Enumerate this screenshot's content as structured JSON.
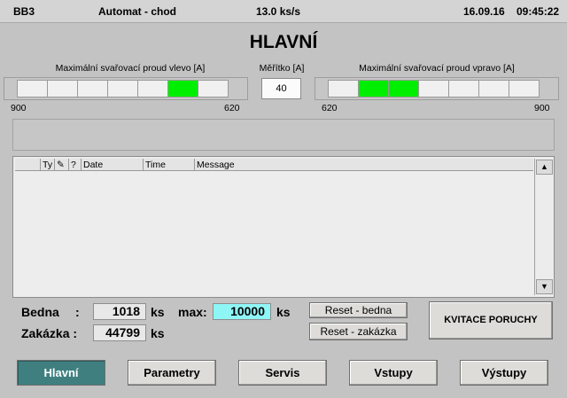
{
  "status": {
    "station": "BB3",
    "mode": "Automat - chod",
    "rate": "13.0 ks/s",
    "date": "16.09.16",
    "time": "09:45:22"
  },
  "title": "HLAVNÍ",
  "gauge_left": {
    "label": "Maximální svařovací proud vlevo [A]",
    "min_label": "900",
    "max_label": "620",
    "segments": [
      false,
      false,
      false,
      false,
      false,
      true,
      false
    ]
  },
  "scale": {
    "label": "Měřítko [A]",
    "value": "40"
  },
  "gauge_right": {
    "label": "Maximální svařovací proud vpravo [A]",
    "min_label": "620",
    "max_label": "900",
    "segments": [
      false,
      true,
      true,
      false,
      false,
      false,
      false
    ]
  },
  "messages": {
    "columns": [
      "Ty",
      "",
      "?",
      "Date",
      "Time",
      "Message"
    ],
    "rows": []
  },
  "counters": {
    "bedna_label": "Bedna",
    "bedna_colon": ":",
    "bedna_value": "1018",
    "bedna_unit": "ks",
    "max_label": "max:",
    "max_value": "10000",
    "max_unit": "ks",
    "zakazka_label": "Zakázka :",
    "zakazka_value": "44799",
    "zakazka_unit": "ks"
  },
  "buttons": {
    "reset_bedna": "Reset - bedna",
    "reset_zakazka": "Reset - zakázka",
    "kvitace": "KVITACE PORUCHY"
  },
  "nav": [
    "Hlavní",
    "Parametry",
    "Servis",
    "Vstupy",
    "Výstupy"
  ],
  "colors": {
    "segment_on": "#00ee00",
    "nav_active": "#3f7f80",
    "max_field": "#8ff6f6"
  }
}
